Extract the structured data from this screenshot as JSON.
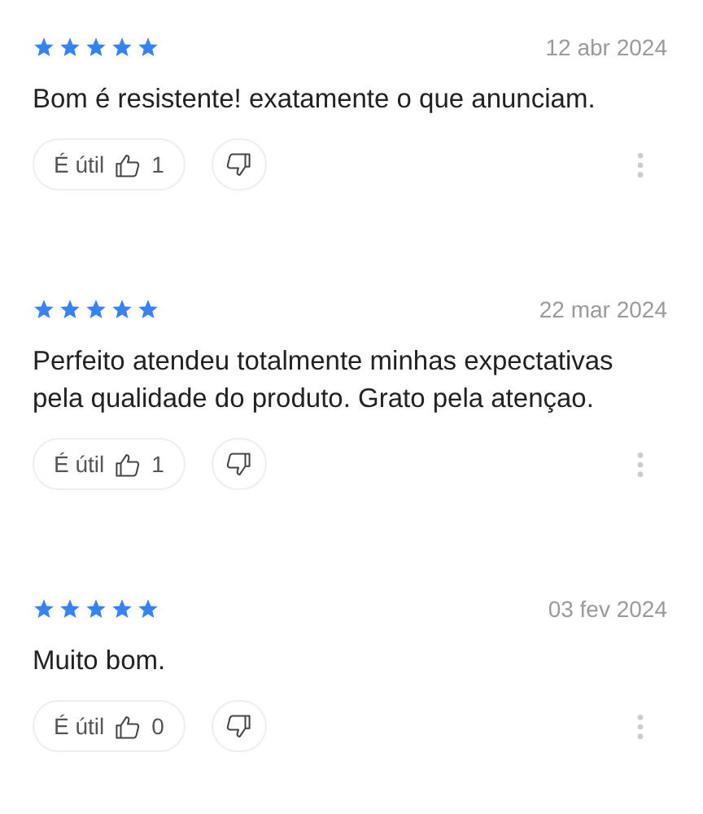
{
  "reviews": [
    {
      "stars": 5,
      "date": "12 abr 2024",
      "text": "Bom é resistente! exatamente o que anunciam.",
      "helpful_label": "É útil",
      "helpful_count": "1"
    },
    {
      "stars": 5,
      "date": "22 mar 2024",
      "text": "Perfeito atendeu totalmente minhas expectativas pela qualidade do produto. Grato pela atençao.",
      "helpful_label": "É útil",
      "helpful_count": "1"
    },
    {
      "stars": 5,
      "date": "03 fev 2024",
      "text": "Muito bom.",
      "helpful_label": "É útil",
      "helpful_count": "0"
    }
  ]
}
